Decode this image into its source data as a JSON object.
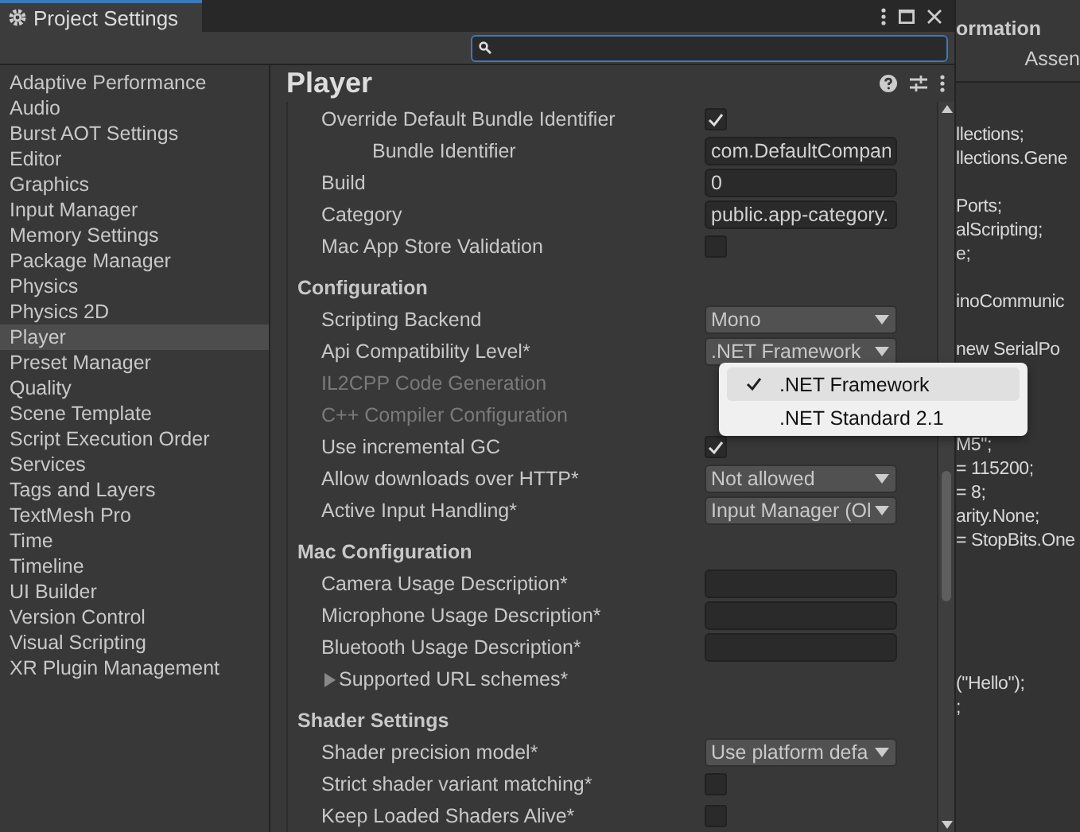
{
  "window": {
    "title": "Project Settings"
  },
  "search": {
    "focused": true
  },
  "sidebar": {
    "items": [
      {
        "label": "Adaptive Performance",
        "selected": false
      },
      {
        "label": "Audio",
        "selected": false
      },
      {
        "label": "Burst AOT Settings",
        "selected": false
      },
      {
        "label": "Editor",
        "selected": false
      },
      {
        "label": "Graphics",
        "selected": false
      },
      {
        "label": "Input Manager",
        "selected": false
      },
      {
        "label": "Memory Settings",
        "selected": false
      },
      {
        "label": "Package Manager",
        "selected": false
      },
      {
        "label": "Physics",
        "selected": false
      },
      {
        "label": "Physics 2D",
        "selected": false
      },
      {
        "label": "Player",
        "selected": true
      },
      {
        "label": "Preset Manager",
        "selected": false
      },
      {
        "label": "Quality",
        "selected": false
      },
      {
        "label": "Scene Template",
        "selected": false
      },
      {
        "label": "Script Execution Order",
        "selected": false
      },
      {
        "label": "Services",
        "selected": false
      },
      {
        "label": "Tags and Layers",
        "selected": false
      },
      {
        "label": "TextMesh Pro",
        "selected": false
      },
      {
        "label": "Time",
        "selected": false
      },
      {
        "label": "Timeline",
        "selected": false
      },
      {
        "label": "UI Builder",
        "selected": false
      },
      {
        "label": "Version Control",
        "selected": false
      },
      {
        "label": "Visual Scripting",
        "selected": false
      },
      {
        "label": "XR Plugin Management",
        "selected": false
      }
    ]
  },
  "panel": {
    "title": "Player",
    "rows": [
      {
        "kind": "checkbox",
        "label": "Override Default Bundle Identifier",
        "checked": true,
        "indented": false
      },
      {
        "kind": "text",
        "label": "Bundle Identifier",
        "value": "com.DefaultCompan",
        "indented": true
      },
      {
        "kind": "text",
        "label": "Build",
        "value": "0",
        "indented": false
      },
      {
        "kind": "text",
        "label": "Category",
        "value": "public.app-category.",
        "indented": false
      },
      {
        "kind": "checkbox",
        "label": "Mac App Store Validation",
        "checked": false,
        "indented": false
      },
      {
        "kind": "heading",
        "label": "Configuration"
      },
      {
        "kind": "dropdown",
        "label": "Scripting Backend",
        "value": "Mono"
      },
      {
        "kind": "dropdown",
        "label": "Api Compatibility Level*",
        "value": ".NET Framework"
      },
      {
        "kind": "plain",
        "label": "IL2CPP Code Generation",
        "disabled": true
      },
      {
        "kind": "plain",
        "label": "C++ Compiler Configuration",
        "disabled": true
      },
      {
        "kind": "checkbox",
        "label": "Use incremental GC",
        "checked": true,
        "indented": false
      },
      {
        "kind": "dropdown",
        "label": "Allow downloads over HTTP*",
        "value": "Not allowed"
      },
      {
        "kind": "dropdown",
        "label": "Active Input Handling*",
        "value": "Input Manager (Ol"
      },
      {
        "kind": "heading",
        "label": "Mac Configuration"
      },
      {
        "kind": "text",
        "label": "Camera Usage Description*",
        "indented": false
      },
      {
        "kind": "text",
        "label": "Microphone Usage Description*",
        "indented": false
      },
      {
        "kind": "text",
        "label": "Bluetooth Usage Description*",
        "indented": false
      },
      {
        "kind": "foldout",
        "label": "Supported URL schemes*",
        "expanded": false
      },
      {
        "kind": "heading",
        "label": "Shader Settings"
      },
      {
        "kind": "dropdown",
        "label": "Shader precision model*",
        "value": "Use platform defa"
      },
      {
        "kind": "checkbox",
        "label": "Strict shader variant matching*",
        "checked": false,
        "indented": false
      },
      {
        "kind": "checkbox",
        "label": "Keep Loaded Shaders Alive*",
        "checked": false,
        "indented": false
      }
    ]
  },
  "popup": {
    "items": [
      {
        "label": ".NET Framework",
        "selected": true
      },
      {
        "label": ".NET Standard 2.1",
        "selected": false
      }
    ]
  },
  "background_window": {
    "title": "ormation",
    "column": "Assen",
    "blocks": [
      [
        "llections;",
        "llections.Gene"
      ],
      [
        "Ports;",
        "alScripting;",
        "e;"
      ],
      [
        "inoCommunic"
      ],
      [
        "new SerialPo"
      ],
      [
        "M5\";",
        "= 115200;",
        "= 8;",
        "arity.None;",
        "= StopBits.One"
      ],
      [
        "(\"Hello\");",
        ";"
      ]
    ]
  }
}
